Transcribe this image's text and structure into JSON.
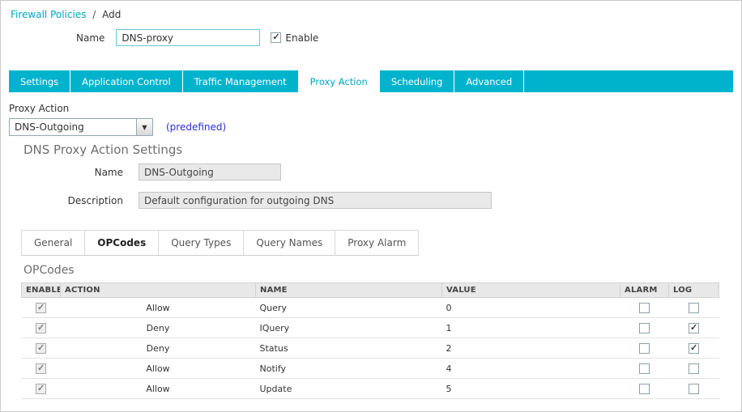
{
  "breadcrumb": {
    "link": "Firewall Policies",
    "separator": "/",
    "current": "Add"
  },
  "name_field": {
    "label": "Name",
    "value": "DNS-proxy"
  },
  "enable_checkbox": {
    "label": "Enable",
    "checked": true
  },
  "tabs": {
    "items": [
      {
        "label": "Settings",
        "active": false
      },
      {
        "label": "Application Control",
        "active": false
      },
      {
        "label": "Traffic Management",
        "active": false
      },
      {
        "label": "Proxy Action",
        "active": true
      },
      {
        "label": "Scheduling",
        "active": false
      },
      {
        "label": "Advanced",
        "active": false
      }
    ]
  },
  "proxy_action": {
    "label": "Proxy Action",
    "dropdown_value": "DNS-Outgoing",
    "predefined_note": "(predefined)"
  },
  "settings_section": {
    "title": "DNS Proxy Action Settings",
    "name": {
      "label": "Name",
      "value": "DNS-Outgoing"
    },
    "description": {
      "label": "Description",
      "value": "Default configuration for outgoing DNS"
    }
  },
  "subtabs": {
    "items": [
      {
        "label": "General",
        "active": false
      },
      {
        "label": "OPCodes",
        "active": true
      },
      {
        "label": "Query Types",
        "active": false
      },
      {
        "label": "Query Names",
        "active": false
      },
      {
        "label": "Proxy Alarm",
        "active": false
      }
    ]
  },
  "opcodes": {
    "title": "OPCodes",
    "columns": [
      "ENABLED",
      "ACTION",
      "NAME",
      "VALUE",
      "ALARM",
      "LOG"
    ],
    "rows": [
      {
        "enabled": true,
        "action": "Allow",
        "name": "Query",
        "value": "0",
        "alarm": false,
        "log": false
      },
      {
        "enabled": true,
        "action": "Deny",
        "name": "IQuery",
        "value": "1",
        "alarm": false,
        "log": true
      },
      {
        "enabled": true,
        "action": "Deny",
        "name": "Status",
        "value": "2",
        "alarm": false,
        "log": true
      },
      {
        "enabled": true,
        "action": "Allow",
        "name": "Notify",
        "value": "4",
        "alarm": false,
        "log": false
      },
      {
        "enabled": true,
        "action": "Allow",
        "name": "Update",
        "value": "5",
        "alarm": false,
        "log": false
      }
    ]
  },
  "icons": {
    "dropdown_arrow": "▼"
  },
  "colors": {
    "accent": "#00b3cd",
    "active_tab_text": "#00a6c6",
    "predefined_link": "#2d2dd8"
  }
}
